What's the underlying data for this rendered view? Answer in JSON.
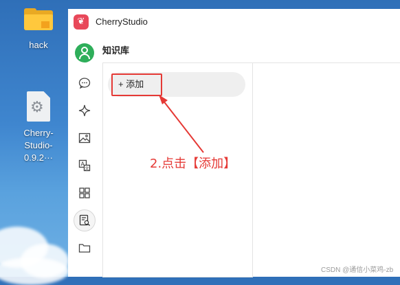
{
  "desktop": {
    "icons": [
      {
        "label": "hack",
        "icon": "folder-icon"
      },
      {
        "label": "Cherry-\nStudio-0.9.2···",
        "label_line1": "Cherry-",
        "label_line2": "Studio-0.9.2···",
        "icon": "settings-file-icon"
      }
    ]
  },
  "window": {
    "app_title": "CherryStudio",
    "page_title": "知识库",
    "add_button_label": "+ 添加"
  },
  "sidebar": {
    "items": [
      {
        "name": "chat-icon"
      },
      {
        "name": "sparkle-icon"
      },
      {
        "name": "image-icon"
      },
      {
        "name": "translate-icon"
      },
      {
        "name": "apps-grid-icon"
      },
      {
        "name": "knowledge-base-icon",
        "active": true
      },
      {
        "name": "folder-icon"
      }
    ]
  },
  "annotation": {
    "text": "2.点击【添加】",
    "color": "#e53935"
  },
  "watermark": "CSDN @通信小菜鸡-zb",
  "colors": {
    "accent_red": "#e53935",
    "app_logo": "#e8485a",
    "avatar_green": "#2eae5a"
  }
}
